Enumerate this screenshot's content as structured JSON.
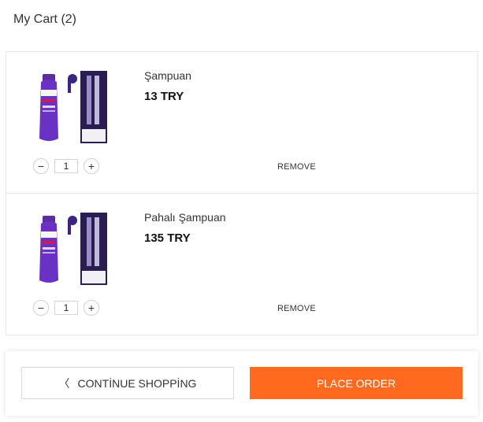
{
  "header": {
    "title": "My Cart (2)"
  },
  "cart": {
    "items": [
      {
        "name": "Şampuan",
        "price": "13 TRY",
        "quantity": "1",
        "remove_label": "REMOVE",
        "image_icon": "shampoo-bottle-icon"
      },
      {
        "name": "Pahalı Şampuan",
        "price": "135 TRY",
        "quantity": "1",
        "remove_label": "REMOVE",
        "image_icon": "shampoo-bottle-icon"
      }
    ],
    "decrement_symbol": "−",
    "increment_symbol": "+"
  },
  "footer": {
    "continue_label": "CONTİNUE SHOPPİNG",
    "continue_icon": "chevron-left-icon",
    "order_label": "PLACE ORDER"
  },
  "colors": {
    "accent": "#ff6a1f",
    "border": "#e6e6e6"
  }
}
